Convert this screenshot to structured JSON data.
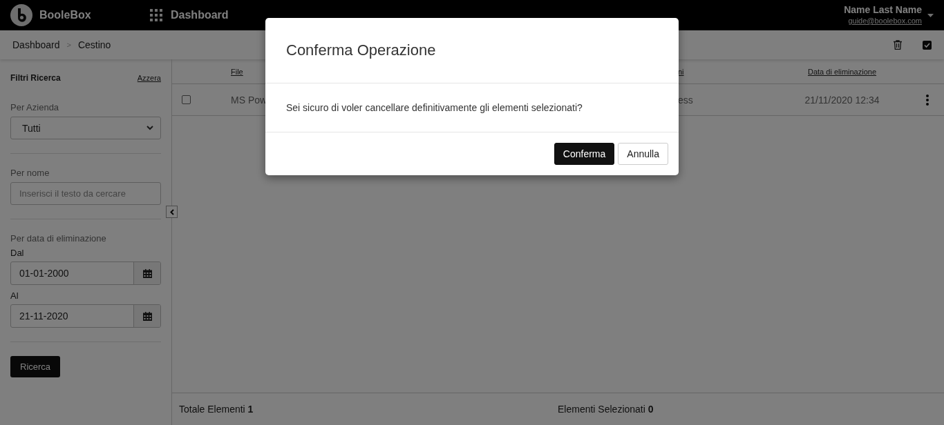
{
  "header": {
    "brand": "BooleBox",
    "title": "Dashboard",
    "user_name": "Name Last Name",
    "user_email": "guide@boolebox.com"
  },
  "breadcrumb": {
    "items": [
      "Dashboard",
      "Cestino"
    ],
    "separator": ">"
  },
  "sidebar": {
    "title": "Filtri Ricerca",
    "reset_link": "Azzera",
    "company_label": "Per Azienda",
    "company_value": "Tutti",
    "name_label": "Per nome",
    "name_placeholder": "Inserisci il testo da cercare",
    "date_label": "Per data di eliminazione",
    "from_label": "Dal",
    "from_value": "01-01-2000",
    "to_label": "Al",
    "to_value": "21-11-2020",
    "search_button": "Ricerca"
  },
  "table": {
    "columns": [
      "File",
      "ni",
      "Data di eliminazione"
    ],
    "rows": [
      {
        "selected": false,
        "cells": [
          "MS Pow",
          "ess",
          "21/11/2020 12:34"
        ]
      }
    ]
  },
  "footer": {
    "total": "Totale Elementi **1**",
    "selected": "Elementi Selezionati **0**"
  },
  "dialog": {
    "title": "Conferma Operazione",
    "message": "Sei sicuro di voler cancellare definitivamente gli elementi selezionati?",
    "buttons": [
      {
        "label": "Conferma",
        "kind": "primary"
      },
      {
        "label": "Annulla",
        "kind": "secondary"
      }
    ]
  }
}
